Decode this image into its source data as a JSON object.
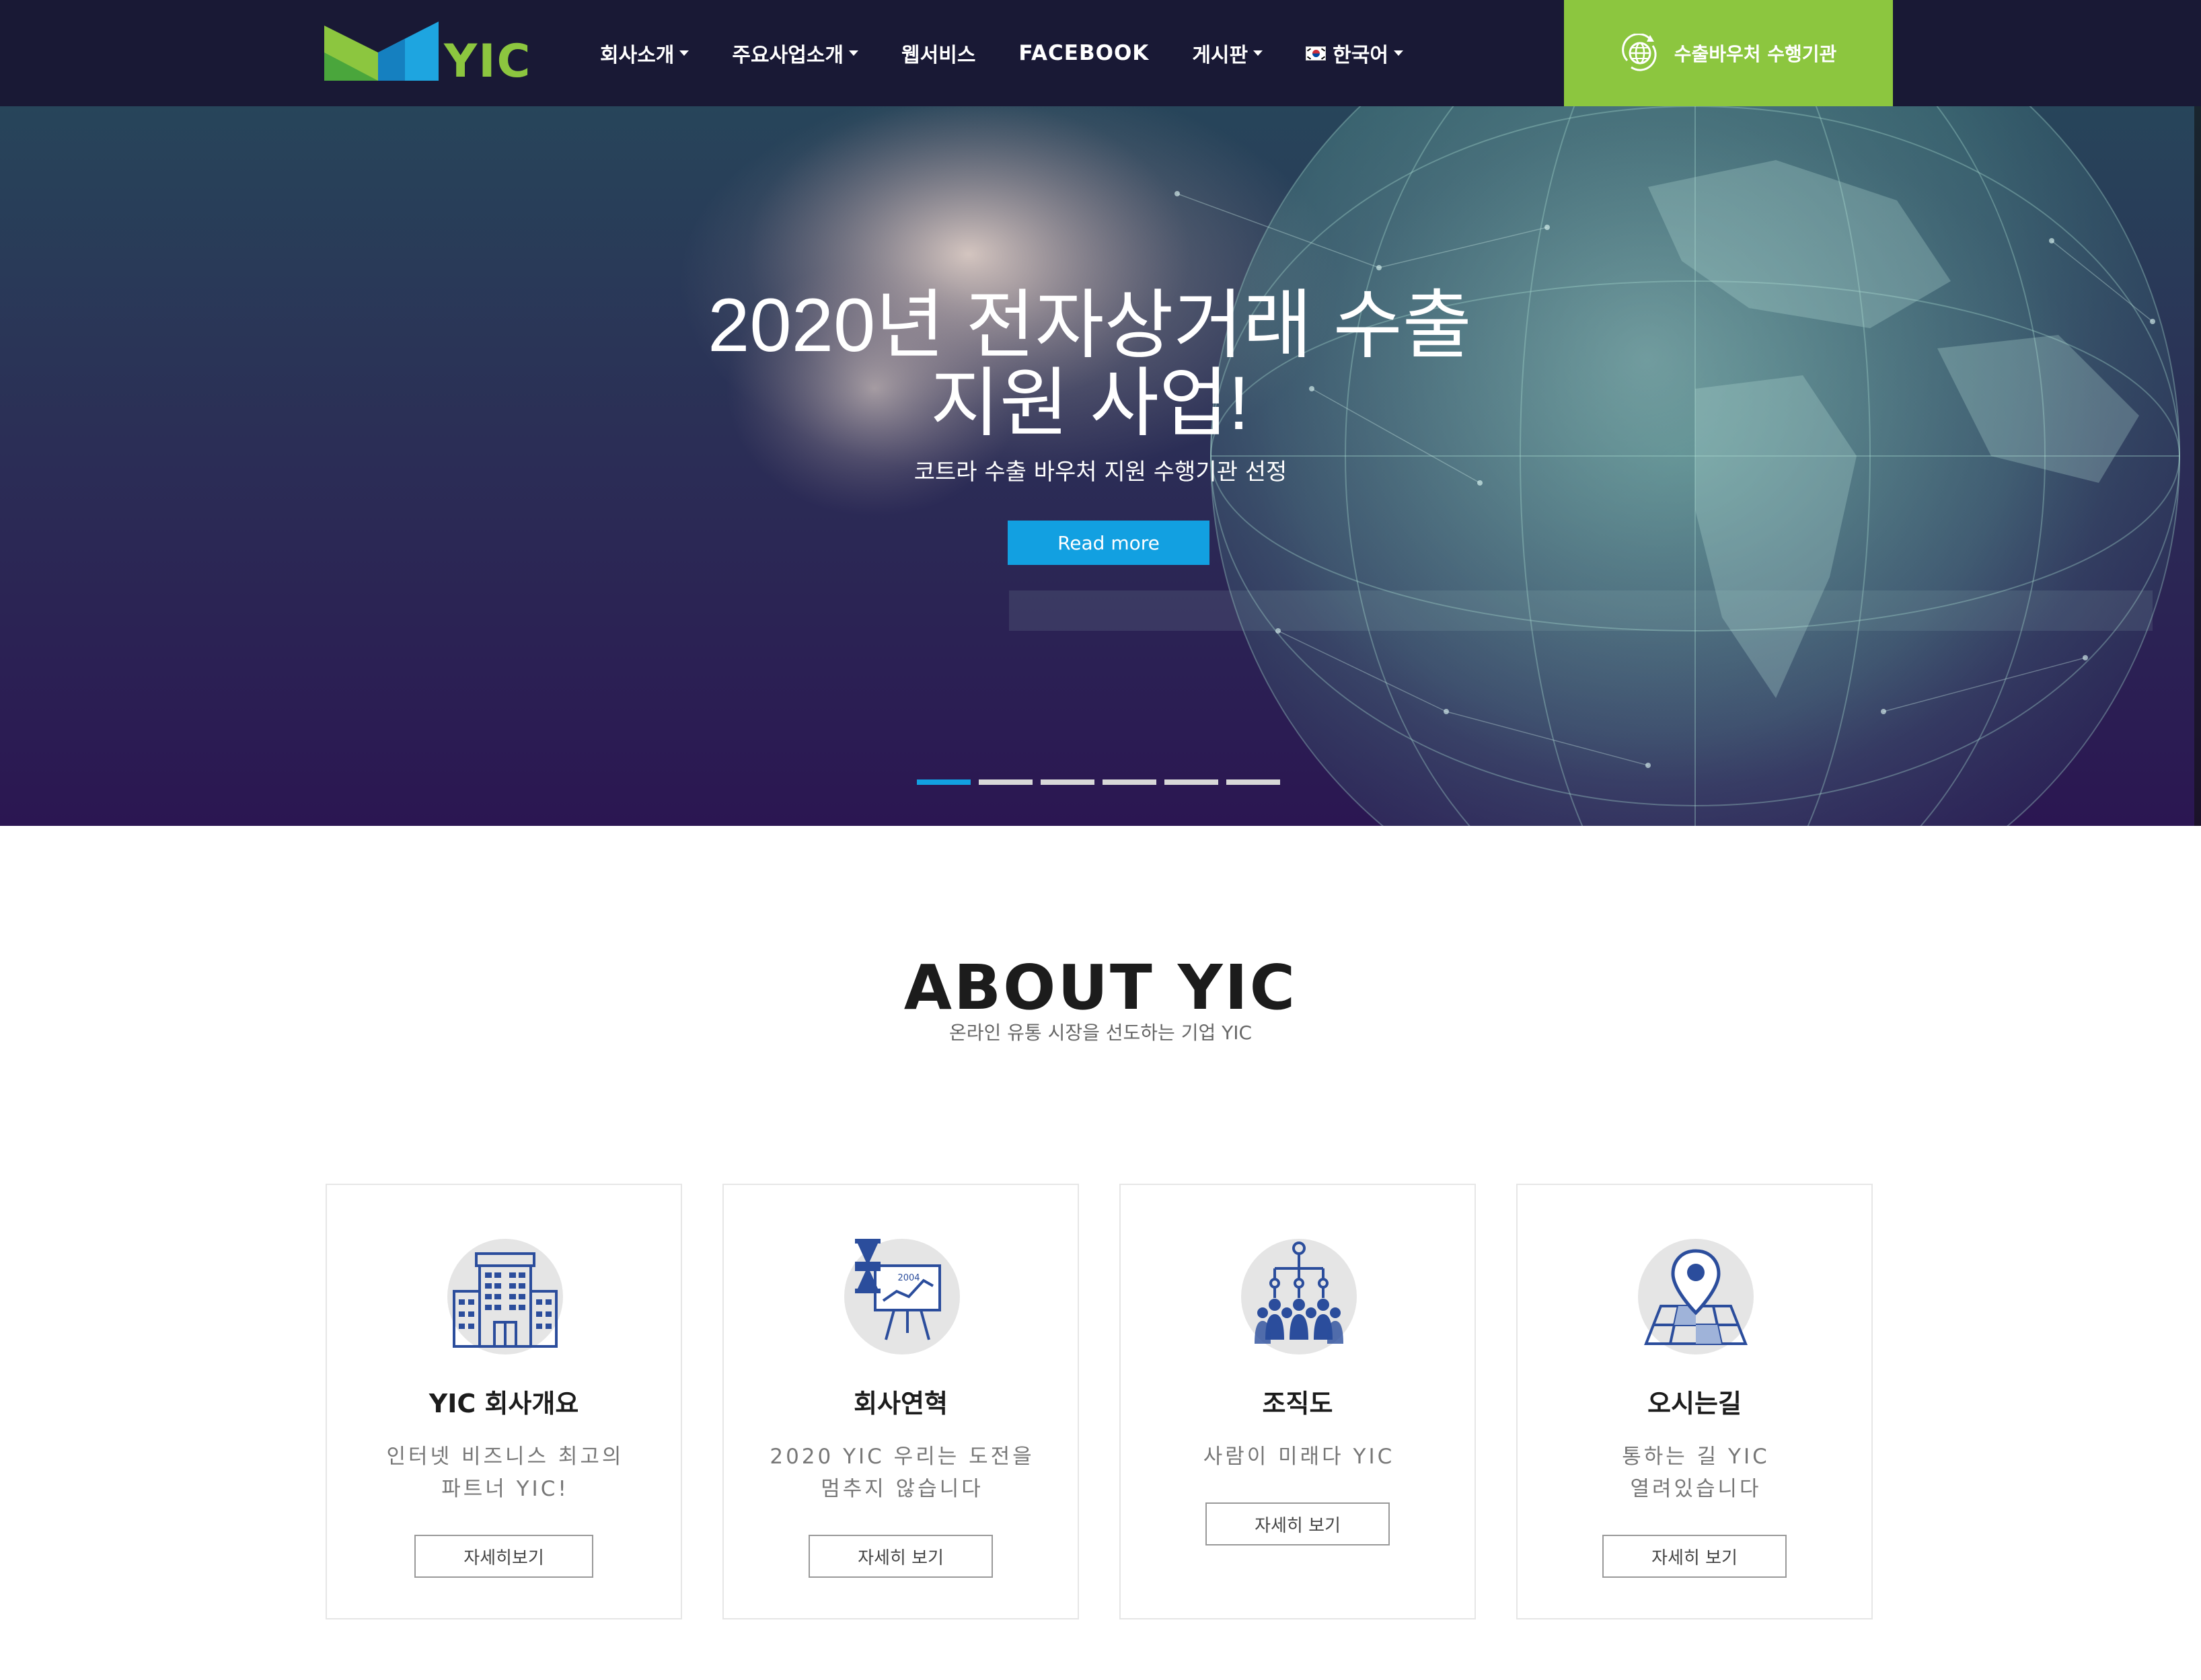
{
  "header": {
    "logo_text": "YIC",
    "nav": [
      {
        "label": "회사소개",
        "has_dropdown": true
      },
      {
        "label": "주요사업소개",
        "has_dropdown": true
      },
      {
        "label": "웹서비스",
        "has_dropdown": false
      },
      {
        "label": "FACEBOOK",
        "has_dropdown": false
      },
      {
        "label": "게시판",
        "has_dropdown": true
      },
      {
        "label": "한국어",
        "has_dropdown": true,
        "icon": "korea-flag-icon"
      }
    ],
    "voucher_button": {
      "label": "수출바우처 수행기관",
      "icon": "globe-refresh-icon"
    }
  },
  "hero": {
    "title_line1": "2020년 전자상거래 수출",
    "title_line2": "지원 사업!",
    "subtitle": "코트라 수출 바우처 지원 수행기관 선정",
    "button": "Read more",
    "slide_count": 6,
    "active_slide": 1
  },
  "about": {
    "title": "ABOUT YIC",
    "subtitle": "온라인 유통 시장을 선도하는 기업 YIC",
    "cards": [
      {
        "icon": "building-icon",
        "title": "YIC 회사개요",
        "desc_line1": "인터넷 비즈니스 최고의",
        "desc_line2": "파트너 YIC!",
        "button": "자세히보기"
      },
      {
        "icon": "history-board-icon",
        "icon_text": "2004",
        "title": "회사연혁",
        "desc_line1": "2020 YIC 우리는 도전을",
        "desc_line2": "멈추지 않습니다",
        "button": "자세히 보기"
      },
      {
        "icon": "org-chart-icon",
        "title": "조직도",
        "desc_line1": "사람이 미래다 YIC",
        "desc_line2": "",
        "button": "자세히 보기"
      },
      {
        "icon": "map-pin-icon",
        "title": "오시는길",
        "desc_line1": "통하는 길 YIC",
        "desc_line2": "열려있습니다",
        "button": "자세히 보기"
      }
    ]
  },
  "colors": {
    "header_bg": "#191935",
    "accent_green": "#8cc63f",
    "accent_blue": "#12a0e1",
    "icon_blue": "#2b4d9c"
  }
}
